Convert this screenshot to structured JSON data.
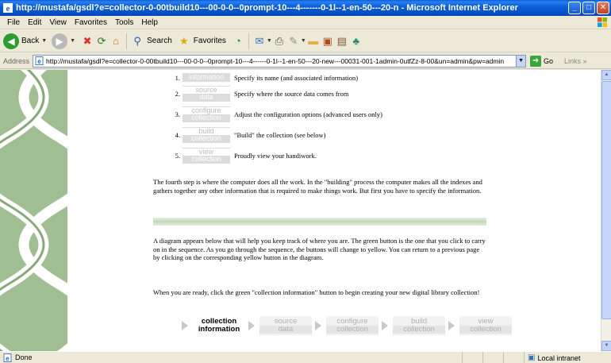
{
  "window": {
    "title": "http://mustafa/gsdl?e=collector-0-00tbuild10---00-0-0--0prompt-10---4-------0-1l--1-en-50---20-n - Microsoft Internet Explorer",
    "min_label": "_",
    "max_label": "□",
    "close_label": "✕"
  },
  "menu": {
    "items": [
      "File",
      "Edit",
      "View",
      "Favorites",
      "Tools",
      "Help"
    ]
  },
  "toolbar": {
    "back_label": "Back",
    "search_label": "Search",
    "favorites_label": "Favorites"
  },
  "address": {
    "label": "Address",
    "value": "http://mustafa/gsdl?e=collector-0-00tbuild10---00-0-0--0prompt-10---4------0-1l--1-en-50---20-new---00031-001-1admin-0utfZz-8-00&un=admin&pw=admin",
    "go_label": "Go",
    "links_label": "Links"
  },
  "steps": [
    {
      "num": "1.",
      "top": "",
      "bottom": "information",
      "desc": "Specify its name (and associated information)"
    },
    {
      "num": "2.",
      "top": "source",
      "bottom": "data",
      "desc": "Specify where the source data comes from"
    },
    {
      "num": "3.",
      "top": "configure",
      "bottom": "collection",
      "desc": "Adjust the configuration options (advanced users only)"
    },
    {
      "num": "4.",
      "top": "build",
      "bottom": "collection",
      "desc": "\"Build\" the collection (see below)"
    },
    {
      "num": "5.",
      "top": "view",
      "bottom": "collection",
      "desc": "Proudly view your handiwork."
    }
  ],
  "paragraphs": {
    "p1": "The fourth step is where the computer does all the work. In the \"building\" process the computer makes all the indexes and gathers together any other information that is required to make things work. But first you have to specify the information.",
    "p2": "A diagram appears below that will help you keep track of where you are. The green button is the one that you click to carry on in the sequence. As you go through the sequence, the buttons will change to yellow. You can return to a previous page by clicking on the corresponding yellow button in the diagram.",
    "p3": "When you are ready, click the green \"collection information\" button to begin creating your new digital library collection!"
  },
  "flow": [
    {
      "top": "collection",
      "bottom": "information",
      "active": true
    },
    {
      "top": "source",
      "bottom": "data",
      "active": false
    },
    {
      "top": "configure",
      "bottom": "collection",
      "active": false
    },
    {
      "top": "build",
      "bottom": "collection",
      "active": false
    },
    {
      "top": "view",
      "bottom": "collection",
      "active": false
    }
  ],
  "status": {
    "text": "Done",
    "zone": "Local intranet"
  }
}
